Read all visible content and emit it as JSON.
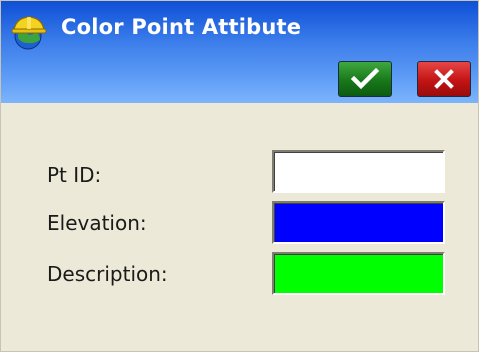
{
  "window": {
    "title": "Color Point Attibute",
    "icon": "hard-hat-globe-icon"
  },
  "toolbar": {
    "ok_icon": "checkmark-icon",
    "cancel_icon": "close-x-icon"
  },
  "form": {
    "fields": [
      {
        "label": "Pt ID:",
        "color": "#ffffff"
      },
      {
        "label": "Elevation:",
        "color": "#0000ff"
      },
      {
        "label": "Description:",
        "color": "#00ff00"
      }
    ]
  },
  "colors": {
    "titlebar": "#3b7dea",
    "ok_button": "#18781a",
    "cancel_button": "#c31414",
    "background": "#ece9d8"
  }
}
